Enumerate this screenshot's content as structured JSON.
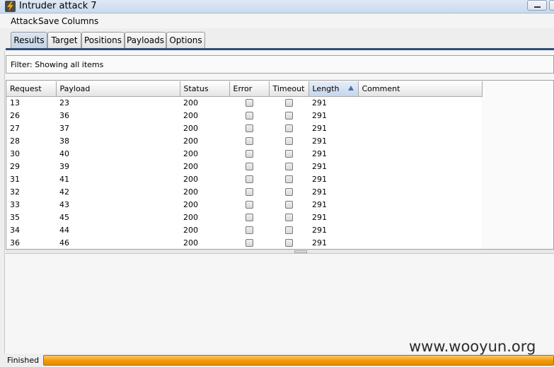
{
  "window": {
    "title": "Intruder attack 7"
  },
  "menu": [
    "Attack",
    "Save",
    "Columns"
  ],
  "tabs": [
    "Results",
    "Target",
    "Positions",
    "Payloads",
    "Options"
  ],
  "active_tab": "Results",
  "filter": {
    "text": "Filter:  Showing all items"
  },
  "table": {
    "columns": [
      "Request",
      "Payload",
      "Status",
      "Error",
      "Timeout",
      "Length",
      "Comment"
    ],
    "sorted_column": "Length",
    "sort_direction": "ascending",
    "rows": [
      {
        "request": "13",
        "payload": "23",
        "status": "200",
        "error": false,
        "timeout": false,
        "length": "291",
        "comment": ""
      },
      {
        "request": "26",
        "payload": "36",
        "status": "200",
        "error": false,
        "timeout": false,
        "length": "291",
        "comment": ""
      },
      {
        "request": "27",
        "payload": "37",
        "status": "200",
        "error": false,
        "timeout": false,
        "length": "291",
        "comment": ""
      },
      {
        "request": "28",
        "payload": "38",
        "status": "200",
        "error": false,
        "timeout": false,
        "length": "291",
        "comment": ""
      },
      {
        "request": "30",
        "payload": "40",
        "status": "200",
        "error": false,
        "timeout": false,
        "length": "291",
        "comment": ""
      },
      {
        "request": "29",
        "payload": "39",
        "status": "200",
        "error": false,
        "timeout": false,
        "length": "291",
        "comment": ""
      },
      {
        "request": "31",
        "payload": "41",
        "status": "200",
        "error": false,
        "timeout": false,
        "length": "291",
        "comment": ""
      },
      {
        "request": "32",
        "payload": "42",
        "status": "200",
        "error": false,
        "timeout": false,
        "length": "291",
        "comment": ""
      },
      {
        "request": "33",
        "payload": "43",
        "status": "200",
        "error": false,
        "timeout": false,
        "length": "291",
        "comment": ""
      },
      {
        "request": "35",
        "payload": "45",
        "status": "200",
        "error": false,
        "timeout": false,
        "length": "291",
        "comment": ""
      },
      {
        "request": "34",
        "payload": "44",
        "status": "200",
        "error": false,
        "timeout": false,
        "length": "291",
        "comment": ""
      },
      {
        "request": "36",
        "payload": "46",
        "status": "200",
        "error": false,
        "timeout": false,
        "length": "291",
        "comment": ""
      }
    ]
  },
  "status": {
    "label": "Finished",
    "progress_fraction": 1.0
  },
  "watermark": "www.wooyun.org",
  "colors": {
    "progress": "#f29a06",
    "tab_line": "#2d4f7a",
    "icon_bolt": "#f2a20c"
  },
  "icons": {
    "app": "lightning-bolt-icon",
    "sort": "sort-ascending-icon"
  }
}
